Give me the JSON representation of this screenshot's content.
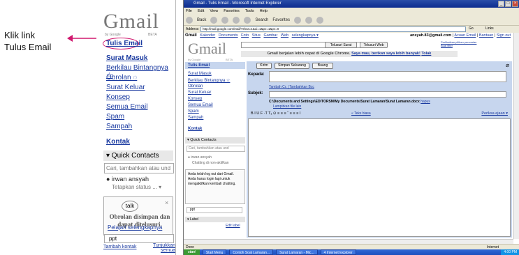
{
  "annotation": {
    "line1": "Klik link",
    "line2": "Tulus Email"
  },
  "zoom_panel": {
    "logo": "Gmail",
    "logo_beta": "BETA",
    "logo_byg": "by Google",
    "compose_link": "Tulis Email",
    "nav": [
      "Surat Masuk",
      "Berkilau Bintangnya ☆",
      "Obrolan ◌",
      "Surat Keluar",
      "Konsep",
      "Semua Email",
      "Spam",
      "Sampah"
    ],
    "contacts": "Kontak",
    "quick_contacts": "▾ Quick Contacts",
    "qc_placeholder": "Cari, tambahkan atau und",
    "qc_user": "● irwan ansyah",
    "qc_status": "Tetapkan status ... ▾",
    "talk_label": "talk",
    "talk_close": "×",
    "talk_message": "Obrolan disimpan dan dapat ditelusuri.",
    "talk_link": "Pelajari selengkapnya",
    "ppt": "ppt",
    "footer_left": "Tambah kontak",
    "footer_right": "Tunjukkan semua",
    "label_head": "▾ Label"
  },
  "browser": {
    "title": "Gmail - Tulis Email - Microsoft Internet Explorer",
    "menu": [
      "File",
      "Edit",
      "View",
      "Favorites",
      "Tools",
      "Help"
    ],
    "toolbar": [
      "Back",
      "Search",
      "Favorites"
    ],
    "address_label": "Address",
    "address": "http://mail.google.com/mail/?shva=1&ui=1&pv=1&pv=0",
    "go": "Go",
    "links": "Links",
    "status_left": "Done",
    "status_right": "Internet"
  },
  "gmail": {
    "topnav_brand": "Gmail",
    "topnav": [
      "Kalender",
      "Documents",
      "Foto",
      "Situs",
      "Gambar",
      "Web",
      "selengkapnya ▾"
    ],
    "account": "ansyah.83@gmail.com",
    "account_links": [
      "Acuan Email",
      "Bantuan",
      "Sign out"
    ],
    "logo": "Gmail",
    "logo_sub": "by Google",
    "logo_beta": "BETA",
    "search_mail": "Telusuri Surat",
    "search_web": "Telusuri Web",
    "search_options": [
      "Perlihatkan pilihan pencarian",
      "Buat filter"
    ],
    "promo_text": "Gmail berjalan lebih cepat di Google Chrome.",
    "promo_link1": "Saya mau, berikan saya lebih banyak!",
    "promo_link2": "Tolak",
    "compose": "Tulis Email",
    "nav": [
      "Surat Masuk",
      "Berkilau Bintangnya ☆",
      "Obrolan",
      "Surat Keluar",
      "Konsep",
      "Semua Email",
      "Spam",
      "Sampah"
    ],
    "contacts": "Kontak",
    "quick_contacts": "▾ Quick Contacts",
    "qc_placeholder": "Cari, tambahkan atau und",
    "qc_user": "● irwan ansyah",
    "qc_status": "Chatting di non-aktifkan",
    "offline_msg": "Anda telah log out dari Gmail. Anda harus login lagi untuk mengaktifkan kembali chatting.",
    "ppt": "ppt",
    "label_head": "▾ Label",
    "edit_label": "Edit label",
    "btn_send": "Kirim",
    "btn_save": "Simpan Sekarang",
    "btn_discard": "Buang",
    "to_label": "Kepada:",
    "subject_label": "Subjek:",
    "add_cc": "Tambah Cc | Tambahkan Bcc",
    "attachment": "C:\\Documents and Settings\\EDITORSM\\My Documents\\Surat Lamaran\\Surat Lamaran.docx",
    "attachment_remove": "hapus",
    "attach_more": "Lampirkan file lain",
    "format_bar": "B  I  U  F  ·T  T₁  ⊙  ≡  ≡  ≡  “  ≡  ≡  ≡  I",
    "plain_text": "« Teks biasa",
    "spell_check": "Periksa ejaan ▾"
  },
  "taskbar": {
    "start": "start",
    "tasks": [
      "Start Menu",
      "Contoh Soal Lamaran...",
      "Surat Lamaran - Mic...",
      "4 Internet Explorer"
    ],
    "clock": "4:00 PM"
  }
}
